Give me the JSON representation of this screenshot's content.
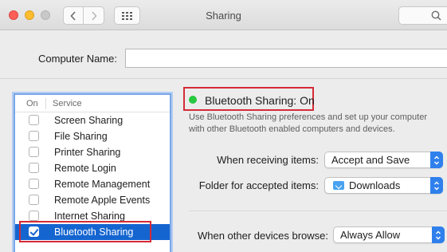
{
  "window": {
    "title": "Sharing"
  },
  "computer_name": {
    "label": "Computer Name:",
    "value": ""
  },
  "services": {
    "header_on": "On",
    "header_service": "Service",
    "items": [
      {
        "label": "Screen Sharing",
        "on": false
      },
      {
        "label": "File Sharing",
        "on": false
      },
      {
        "label": "Printer Sharing",
        "on": false
      },
      {
        "label": "Remote Login",
        "on": false
      },
      {
        "label": "Remote Management",
        "on": false
      },
      {
        "label": "Remote Apple Events",
        "on": false
      },
      {
        "label": "Internet Sharing",
        "on": false
      },
      {
        "label": "Bluetooth Sharing",
        "on": true,
        "selected": true
      }
    ]
  },
  "status": {
    "text": "Bluetooth Sharing: On",
    "color": "#28c840",
    "description_line1": "Use Bluetooth Sharing preferences and set up your computer",
    "description_line2": "with other Bluetooth enabled computers and devices."
  },
  "settings": {
    "receiving_label": "When receiving items:",
    "receiving_value": "Accept and Save",
    "folder_label": "Folder for accepted items:",
    "folder_value": "Downloads",
    "browse_label": "When other devices browse:",
    "browse_value": "Always Allow"
  },
  "colors": {
    "selection": "#1565d0",
    "highlight_box": "#d52b36",
    "accent": "#2f80ec"
  }
}
